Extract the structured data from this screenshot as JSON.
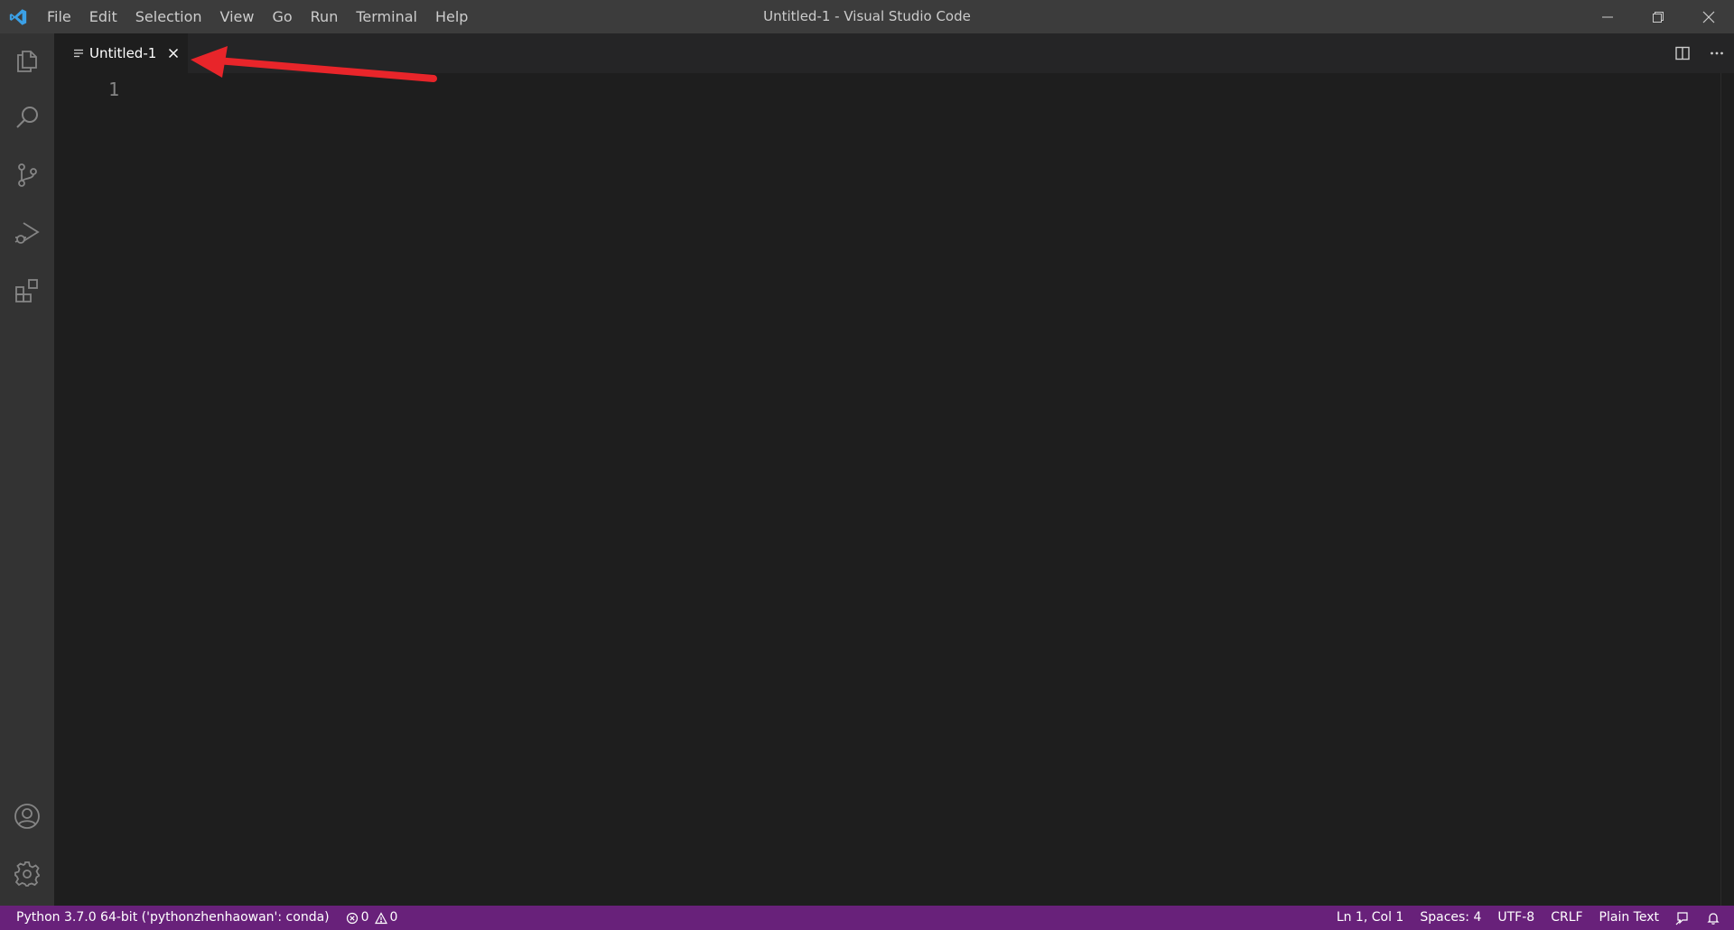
{
  "window": {
    "title": "Untitled-1 - Visual Studio Code"
  },
  "menu": {
    "items": [
      "File",
      "Edit",
      "Selection",
      "View",
      "Go",
      "Run",
      "Terminal",
      "Help"
    ]
  },
  "activity_bar": {
    "top_icons": [
      "files-icon",
      "search-icon",
      "source-control-icon",
      "run-debug-icon",
      "extensions-icon"
    ],
    "bottom_icons": [
      "account-icon",
      "gear-icon"
    ]
  },
  "tabs": [
    {
      "label": "Untitled-1",
      "icon": "file-lines-icon",
      "active": true
    }
  ],
  "editor": {
    "line_numbers": [
      "1"
    ]
  },
  "status_bar": {
    "interpreter": "Python 3.7.0 64-bit ('pythonzhenhaowan': conda)",
    "errors": "0",
    "warnings": "0",
    "cursor": "Ln 1, Col 1",
    "indent": "Spaces: 4",
    "encoding": "UTF-8",
    "eol": "CRLF",
    "language": "Plain Text"
  },
  "colors": {
    "status_bar": "#68217a",
    "annotation_arrow": "#e8252a",
    "logo": "#3ba0e6"
  }
}
